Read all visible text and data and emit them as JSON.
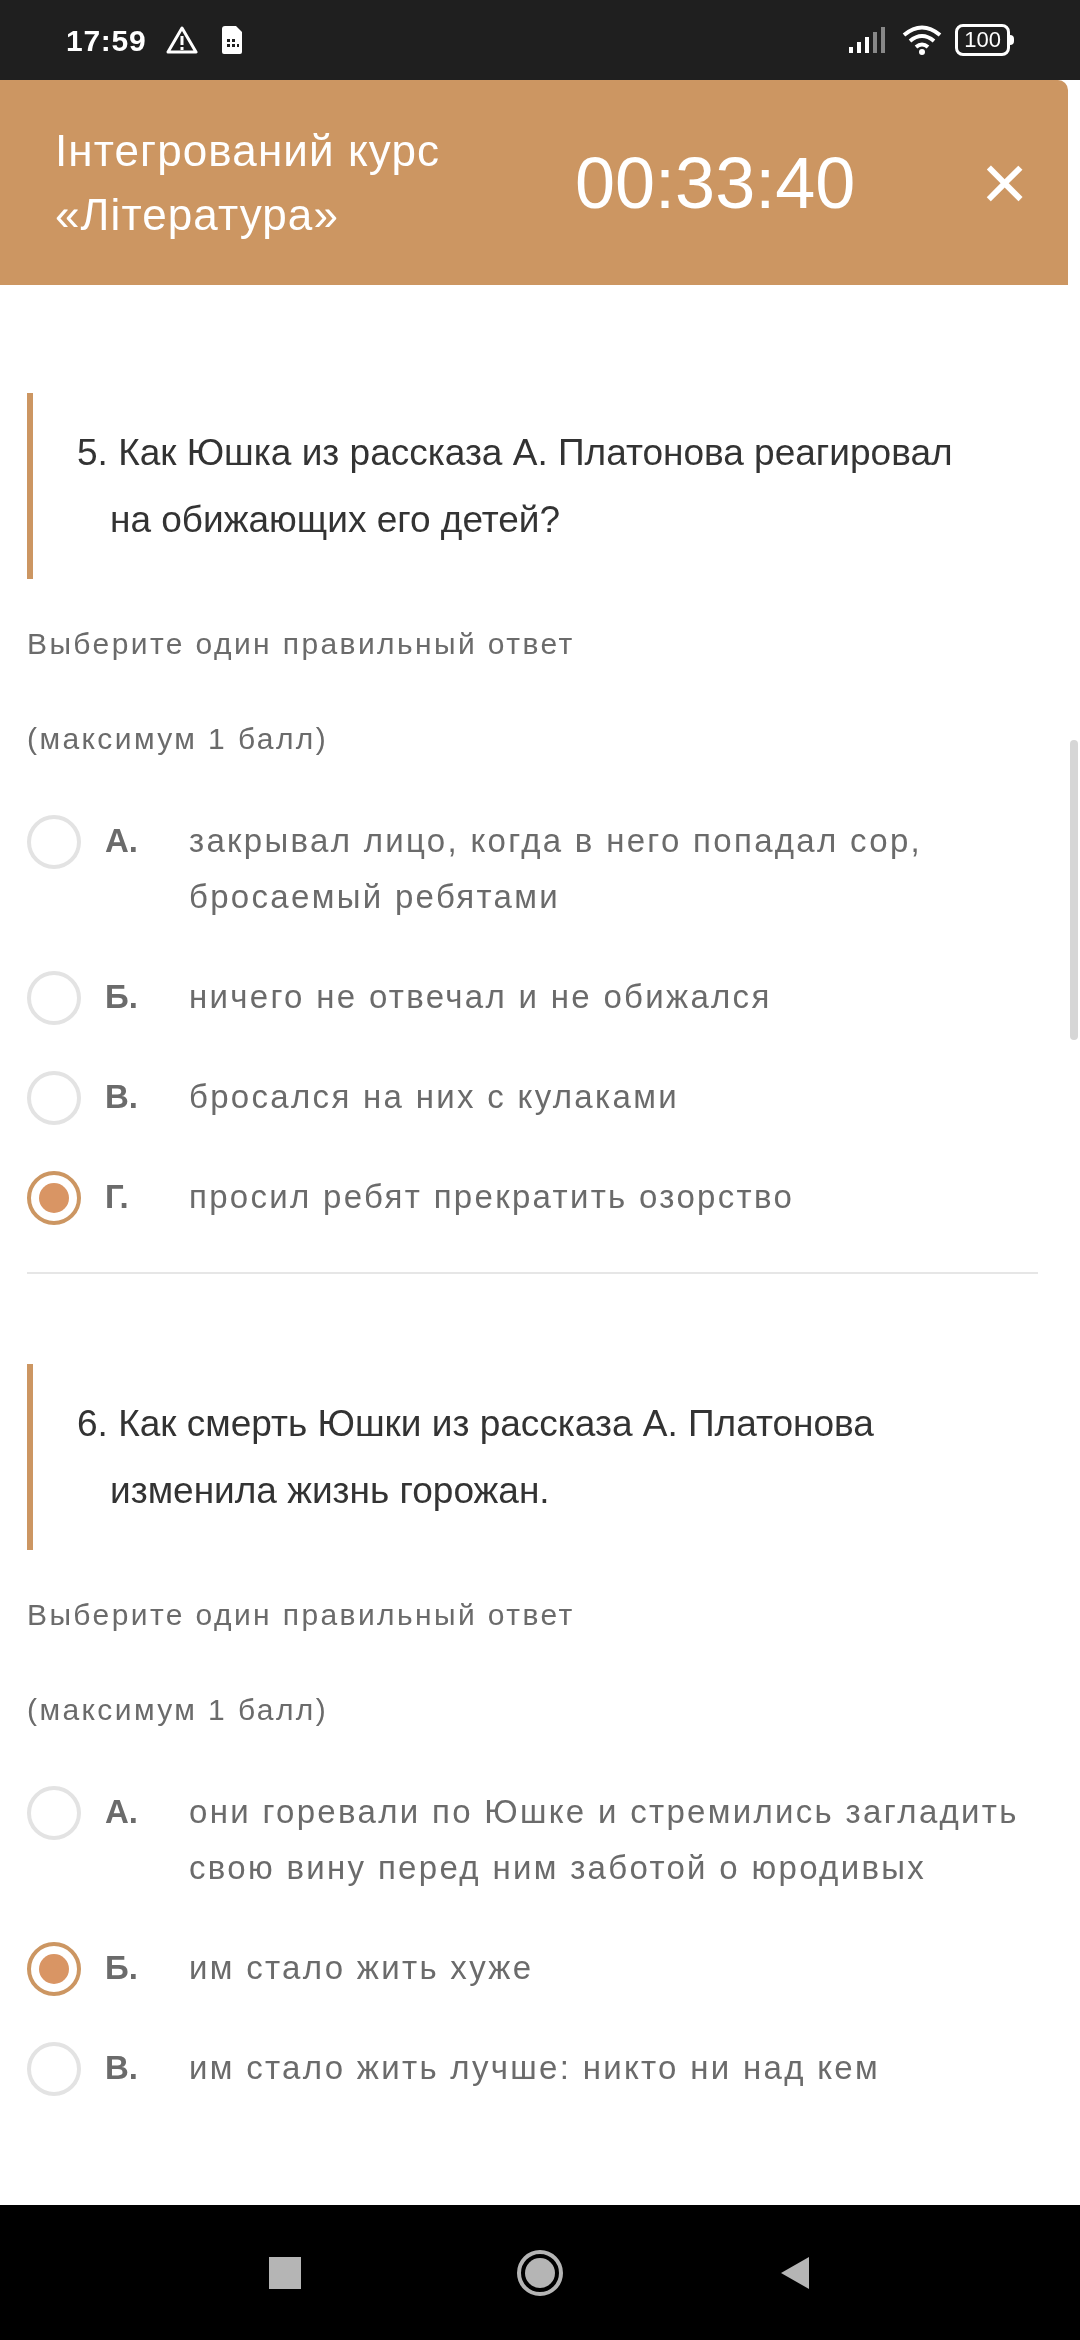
{
  "status_bar": {
    "time": "17:59",
    "battery": "100"
  },
  "header": {
    "title": "Інтегрований курс «Література»",
    "timer": "00:33:40",
    "close": "×"
  },
  "questions": [
    {
      "text": "5. Как Юшка из рассказа А. Платонова реагировал на обижающих его детей?",
      "instruction": "Выберите один правильный ответ",
      "points": "(максимум 1 балл)",
      "options": [
        {
          "letter": "А.",
          "text": "закрывал лицо, когда в него попадал сор, бросаемый ребятами",
          "selected": false
        },
        {
          "letter": "Б.",
          "text": "ничего не отвечал и не обижался",
          "selected": false
        },
        {
          "letter": "В.",
          "text": "бросался на них с кулаками",
          "selected": false
        },
        {
          "letter": "Г.",
          "text": "просил ребят прекратить озорство",
          "selected": true
        }
      ]
    },
    {
      "text": "6. Как смерть Юшки из рассказа А. Платонова изменила жизнь горожан.",
      "instruction": "Выберите один правильный ответ",
      "points": "(максимум 1 балл)",
      "options": [
        {
          "letter": "А.",
          "text": "они горевали по Юшке и стремились загладить свою вину перед ним заботой о юродивых",
          "selected": false
        },
        {
          "letter": "Б.",
          "text": "им стало жить хуже",
          "selected": true
        },
        {
          "letter": "В.",
          "text": "им стало жить лучше: никто ни над кем",
          "selected": false
        }
      ]
    }
  ]
}
